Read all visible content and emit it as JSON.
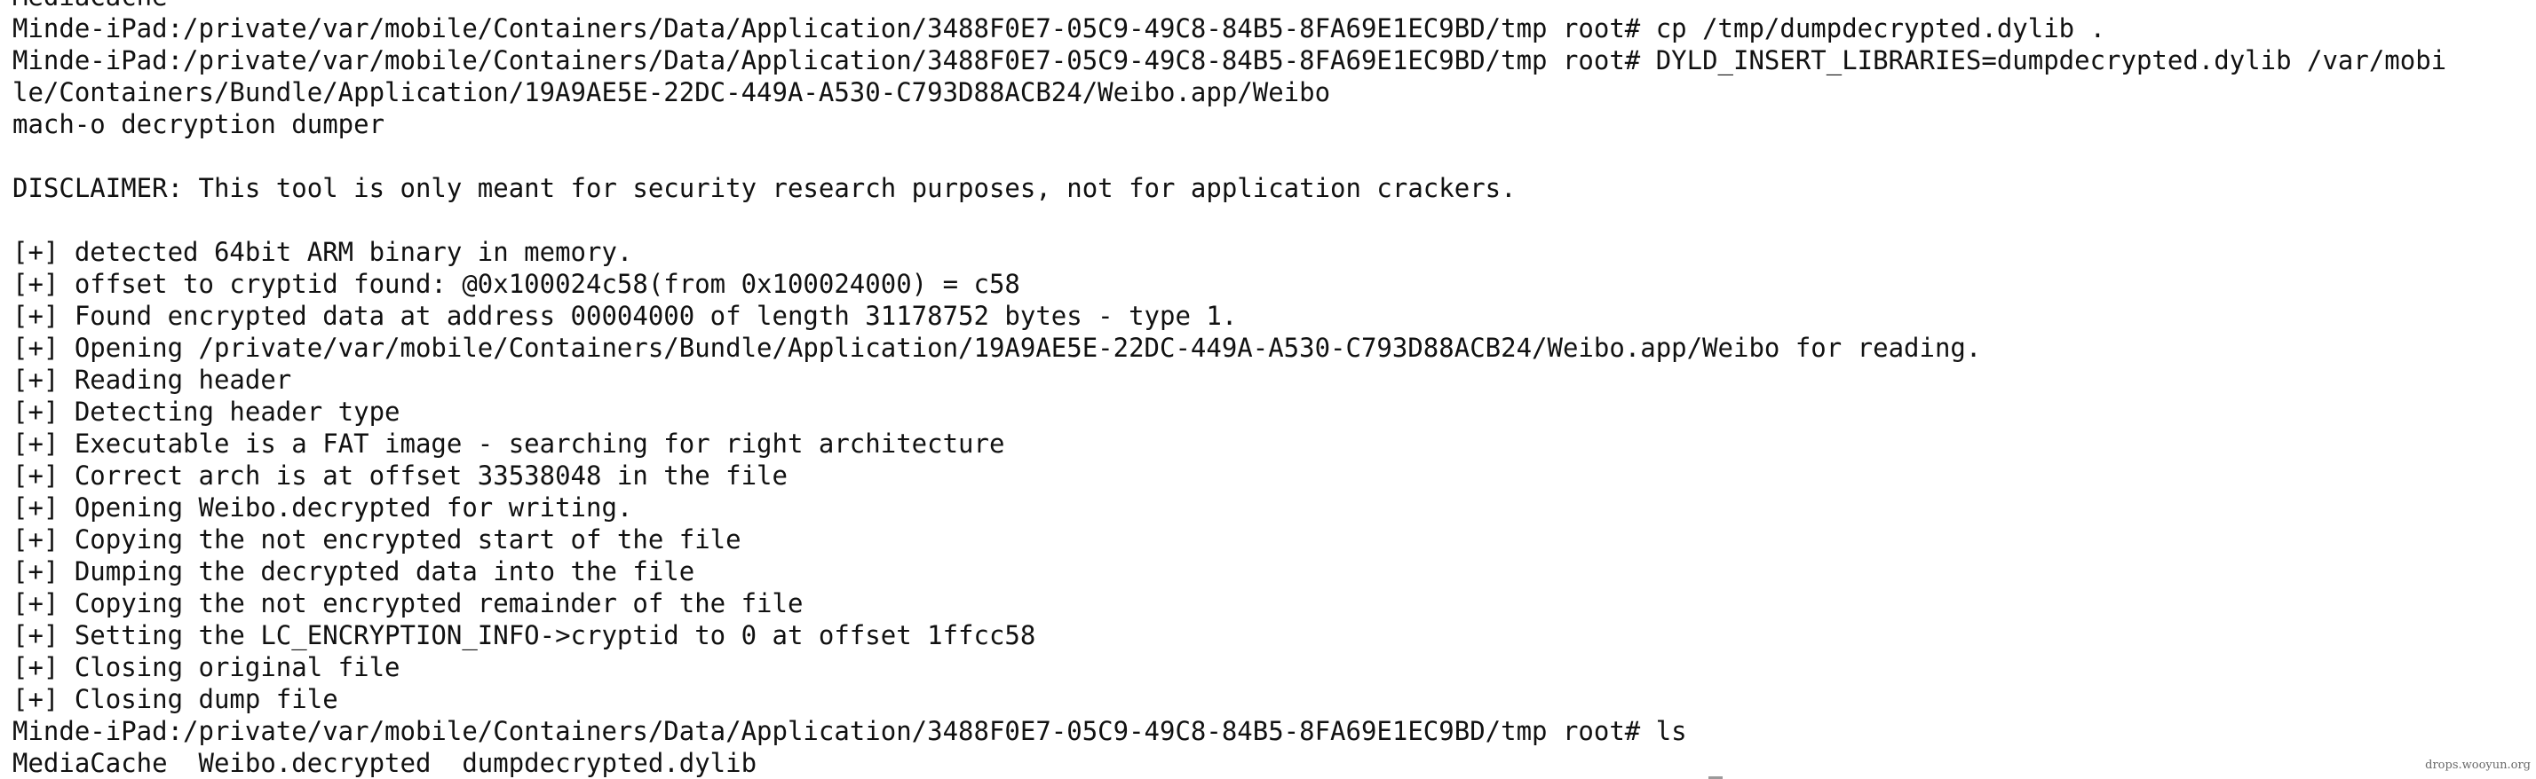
{
  "terminal": {
    "lines": [
      "MediaCache",
      "Minde-iPad:/private/var/mobile/Containers/Data/Application/3488F0E7-05C9-49C8-84B5-8FA69E1EC9BD/tmp root# cp /tmp/dumpdecrypted.dylib .",
      "Minde-iPad:/private/var/mobile/Containers/Data/Application/3488F0E7-05C9-49C8-84B5-8FA69E1EC9BD/tmp root# DYLD_INSERT_LIBRARIES=dumpdecrypted.dylib /var/mobi",
      "le/Containers/Bundle/Application/19A9AE5E-22DC-449A-A530-C793D88ACB24/Weibo.app/Weibo",
      "mach-o decryption dumper",
      "",
      "DISCLAIMER: This tool is only meant for security research purposes, not for application crackers.",
      "",
      "[+] detected 64bit ARM binary in memory.",
      "[+] offset to cryptid found: @0x100024c58(from 0x100024000) = c58",
      "[+] Found encrypted data at address 00004000 of length 31178752 bytes - type 1.",
      "[+] Opening /private/var/mobile/Containers/Bundle/Application/19A9AE5E-22DC-449A-A530-C793D88ACB24/Weibo.app/Weibo for reading.",
      "[+] Reading header",
      "[+] Detecting header type",
      "[+] Executable is a FAT image - searching for right architecture",
      "[+] Correct arch is at offset 33538048 in the file",
      "[+] Opening Weibo.decrypted for writing.",
      "[+] Copying the not encrypted start of the file",
      "[+] Dumping the decrypted data into the file",
      "[+] Copying the not encrypted remainder of the file",
      "[+] Setting the LC_ENCRYPTION_INFO->cryptid to 0 at offset 1ffcc58",
      "[+] Closing original file",
      "[+] Closing dump file",
      "Minde-iPad:/private/var/mobile/Containers/Data/Application/3488F0E7-05C9-49C8-84B5-8FA69E1EC9BD/tmp root# ls",
      "MediaCache  Weibo.decrypted  dumpdecrypted.dylib"
    ]
  },
  "watermark": "drops.wooyun.org",
  "colors": {
    "background": "#ffffff",
    "text": "#111111"
  }
}
